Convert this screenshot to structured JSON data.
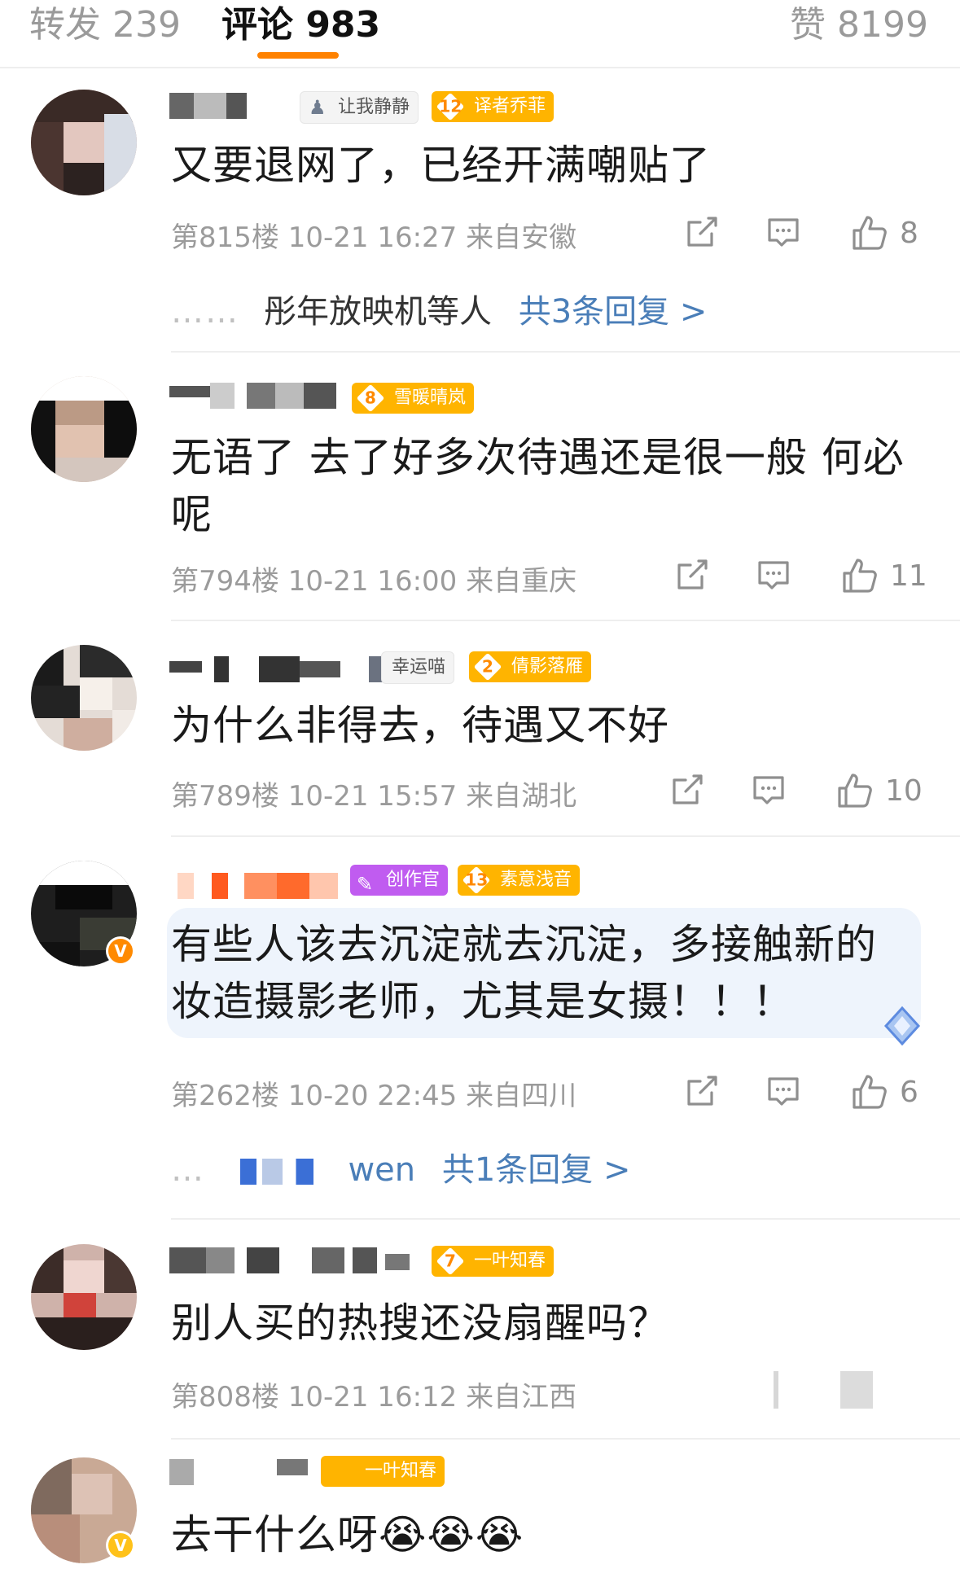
{
  "tabs": {
    "repost": "转发 239",
    "comments": "评论 983",
    "likes": "赞 8199"
  },
  "colors": {
    "accent": "#ff8200",
    "link": "#4a7eb8",
    "fan_badge": "#ffb400",
    "creator_badge": "#c05cf0"
  },
  "comments": [
    {
      "badges": [
        "让我静静",
        "译者乔菲"
      ],
      "fan_level": "12",
      "text": "又要退网了，已经开满嘲贴了",
      "meta": "第815楼  10-21 16:27  来自安徽",
      "likes": "8",
      "reply_names": "彤年放映机等人",
      "reply_count": "共3条回复 >",
      "reply_dots": "……"
    },
    {
      "badges": [
        "雪暖晴岚"
      ],
      "fan_level": "8",
      "text": "无语了 去了好多次待遇还是很一般 何必呢",
      "meta": "第794楼  10-21 16:00  来自重庆",
      "likes": "11"
    },
    {
      "badges": [
        "幸运喵",
        "倩影落雁"
      ],
      "fan_level": "2",
      "text": "为什么非得去，待遇又不好",
      "meta": "第789楼  10-21 15:57  来自湖北",
      "likes": "10"
    },
    {
      "badges": [
        "创作官",
        "素意浅音"
      ],
      "fan_level": "13",
      "text": "有些人该去沉淀就去沉淀，多接触新的妆造摄影老师，尤其是女摄！！！",
      "meta": "第262楼  10-20 22:45  来自四川",
      "likes": "6",
      "reply_names": "wen",
      "reply_count": "共1条回复 >",
      "reply_dots": "…"
    },
    {
      "badges": [
        "一叶知春"
      ],
      "fan_level": "7",
      "text": "别人买的热搜还没扇醒吗？",
      "meta": "第808楼  10-21 16:12  来自江西"
    },
    {
      "badges": [
        "一叶知春"
      ],
      "text": "去干什么呀😭😭😭"
    }
  ],
  "icons": {
    "repost": "share-icon",
    "comment": "comment-icon",
    "like": "thumbs-up-icon",
    "verified": "verified-v-icon"
  },
  "verified_glyph": "V",
  "creator_glyph": "✎"
}
